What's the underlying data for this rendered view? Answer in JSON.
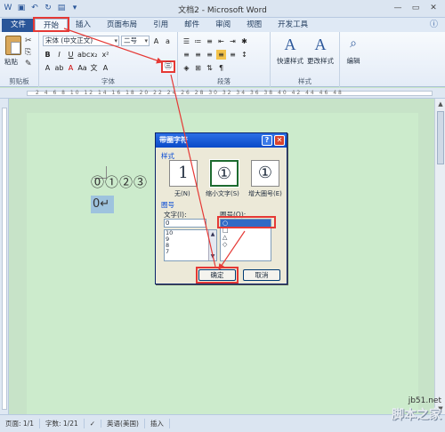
{
  "window": {
    "title": "文档2 - Microsoft Word",
    "controls": [
      "—",
      "▭",
      "✕"
    ]
  },
  "tabs": [
    {
      "label": "文件"
    },
    {
      "label": "开始"
    },
    {
      "label": "插入"
    },
    {
      "label": "页面布局"
    },
    {
      "label": "引用"
    },
    {
      "label": "邮件"
    },
    {
      "label": "审阅"
    },
    {
      "label": "视图"
    },
    {
      "label": "开发工具"
    }
  ],
  "ribbon": {
    "clipboard": {
      "paste": "粘贴",
      "group": "剪贴板"
    },
    "font": {
      "name": "宋体 (中文正文)",
      "size": "二号",
      "group": "字体",
      "enclose_icon": "㊂"
    },
    "paragraph": {
      "group": "段落"
    },
    "styles": {
      "quick": "快速样式",
      "change": "更改样式",
      "group": "样式"
    },
    "editing": {
      "label": "编辑"
    }
  },
  "ruler": {
    "numbers": "2 4 6 8 10 12 14 16 18 20 22 24 26 28 30 32 34 36 38 40 42 44 46 48"
  },
  "document": {
    "circled_line": "⓪①②③",
    "selected_text": "0↵"
  },
  "dialog": {
    "title": "带圈字符",
    "help": "?",
    "close": "✕",
    "style_section": "样式",
    "styles": [
      {
        "glyph": "1",
        "label": "无(N)"
      },
      {
        "glyph": "①",
        "label": "缩小文字(S)"
      },
      {
        "glyph": "①",
        "label": "增大圈号(E)"
      }
    ],
    "circle_section": "圈号",
    "text_label": "文字(I):",
    "text_value": "0",
    "text_list": [
      "0",
      "10",
      "9",
      "8",
      "7"
    ],
    "shape_label": "圈号(O):",
    "shapes": [
      "○",
      "□",
      "△",
      "◇"
    ],
    "ok": "确定",
    "cancel": "取消"
  },
  "statusbar": {
    "page": "页面: 1/1",
    "words": "字数: 1/21",
    "lang": "英语(美国)",
    "mode": "插入"
  },
  "watermark": {
    "url": "jb51.net",
    "site": "脚本之家"
  },
  "colors": {
    "annotation": "#e53935",
    "file_tab": "#2a5699",
    "doc_bg": "#c7e3c8"
  }
}
